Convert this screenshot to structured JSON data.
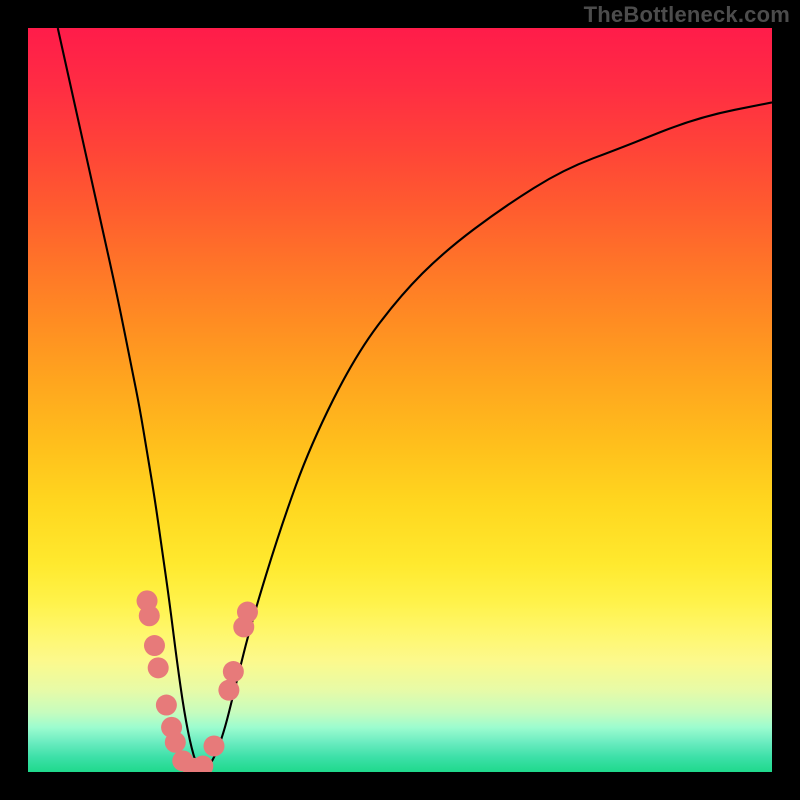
{
  "watermark": "TheBottleneck.com",
  "chart_data": {
    "type": "line",
    "title": "",
    "xlabel": "",
    "ylabel": "",
    "xlim": [
      0,
      100
    ],
    "ylim": [
      0,
      100
    ],
    "grid": false,
    "series": [
      {
        "name": "curve",
        "x": [
          4,
          6,
          8,
          10,
          12,
          14,
          15,
          16,
          17,
          18,
          19,
          20,
          21,
          22,
          23,
          24,
          26,
          28,
          30,
          34,
          38,
          44,
          50,
          56,
          64,
          72,
          80,
          90,
          100
        ],
        "y": [
          100,
          91,
          82,
          73,
          64,
          54,
          49,
          43,
          37,
          30,
          23,
          15,
          8,
          3,
          0,
          0,
          4,
          12,
          20,
          33,
          44,
          56,
          64,
          70,
          76,
          81,
          84,
          88,
          90
        ]
      }
    ],
    "markers": [
      {
        "x": 16.0,
        "y": 23.0
      },
      {
        "x": 16.3,
        "y": 21.0
      },
      {
        "x": 17.0,
        "y": 17.0
      },
      {
        "x": 17.5,
        "y": 14.0
      },
      {
        "x": 18.6,
        "y": 9.0
      },
      {
        "x": 19.3,
        "y": 6.0
      },
      {
        "x": 19.8,
        "y": 4.0
      },
      {
        "x": 20.8,
        "y": 1.5
      },
      {
        "x": 22.2,
        "y": 0.5
      },
      {
        "x": 23.5,
        "y": 0.8
      },
      {
        "x": 25.0,
        "y": 3.5
      },
      {
        "x": 27.0,
        "y": 11.0
      },
      {
        "x": 27.6,
        "y": 13.5
      },
      {
        "x": 29.0,
        "y": 19.5
      },
      {
        "x": 29.5,
        "y": 21.5
      }
    ],
    "marker_color": "#e77a7a",
    "curve_color": "#000000",
    "background": "gradient-red-yellow-green"
  }
}
